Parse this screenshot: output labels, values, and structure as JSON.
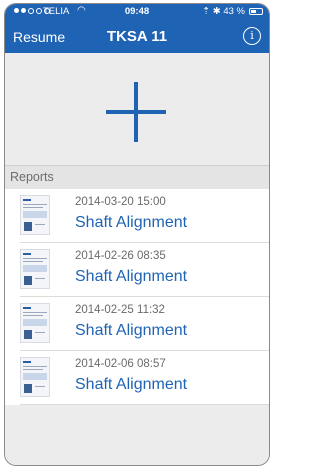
{
  "status_bar": {
    "carrier": "TELIA",
    "wifi_icon": "wifi-icon",
    "time": "09:48",
    "indicators": "⇡ ✱ 43 %",
    "battery_icon": "battery-icon"
  },
  "nav": {
    "back_label": "Resume",
    "title": "TKSA 11",
    "info_icon": "info-icon",
    "info_glyph": "i"
  },
  "add_button": {
    "icon": "plus-icon"
  },
  "reports": {
    "header": "Reports",
    "items": [
      {
        "date": "2014-03-20 15:00",
        "title": "Shaft Alignment"
      },
      {
        "date": "2014-02-26 08:35",
        "title": "Shaft Alignment"
      },
      {
        "date": "2014-02-25 11:32",
        "title": "Shaft Alignment"
      },
      {
        "date": "2014-02-06 08:57",
        "title": "Shaft Alignment"
      }
    ]
  },
  "colors": {
    "accent": "#1f63b5",
    "background": "#ececec",
    "list_background": "#ffffff",
    "secondary_text": "#6a6a6a"
  }
}
